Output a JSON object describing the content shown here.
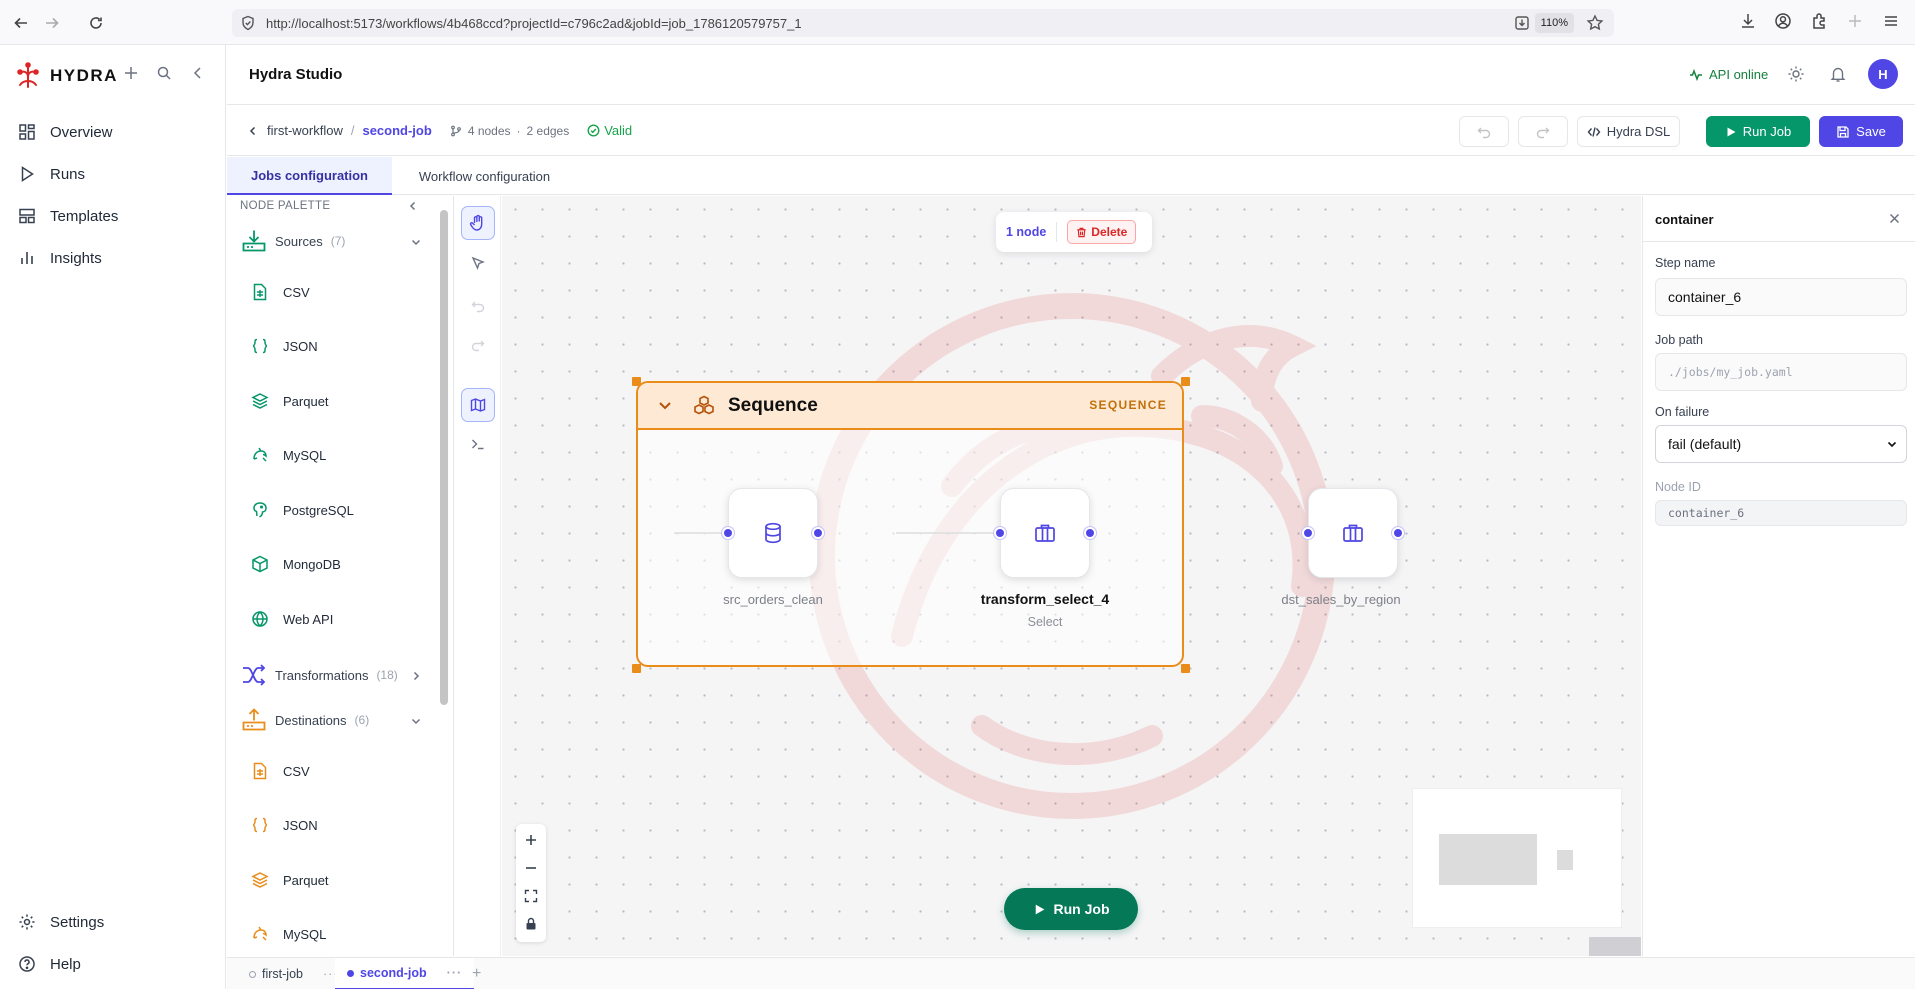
{
  "browser": {
    "url": "http://localhost:5173/workflows/4b468ccd?projectId=c796c2ad&jobId=job_1786120579757_1",
    "zoom": "110%"
  },
  "app": {
    "brand": "HYDRA",
    "title": "Hydra Studio",
    "api_status": "API online",
    "avatar_initial": "H"
  },
  "sidebar": {
    "nav": [
      {
        "label": "Overview",
        "icon": "grid-icon"
      },
      {
        "label": "Runs",
        "icon": "play-icon"
      },
      {
        "label": "Templates",
        "icon": "layout-icon"
      },
      {
        "label": "Insights",
        "icon": "bar-chart-icon"
      }
    ],
    "bottom": [
      {
        "label": "Settings",
        "icon": "gear-icon"
      },
      {
        "label": "Help",
        "icon": "help-icon"
      }
    ]
  },
  "breadcrumb": {
    "workflow": "first-workflow",
    "separator": "/",
    "job": "second-job",
    "nodes": "4 nodes",
    "dot": "·",
    "edges": "2 edges",
    "status": "Valid"
  },
  "actions": {
    "dsl": "Hydra DSL",
    "run": "Run Job",
    "save": "Save"
  },
  "tabs": [
    {
      "label": "Jobs configuration",
      "active": true
    },
    {
      "label": "Workflow configuration",
      "active": false
    }
  ],
  "palette": {
    "header": "NODE PALETTE",
    "groups": [
      {
        "label": "Sources",
        "count": "(7)"
      },
      {
        "label": "Transformations",
        "count": "(18)"
      },
      {
        "label": "Destinations",
        "count": "(6)"
      }
    ],
    "sources": [
      "CSV",
      "JSON",
      "Parquet",
      "MySQL",
      "PostgreSQL",
      "MongoDB",
      "Web API"
    ],
    "destinations": [
      "CSV",
      "JSON",
      "Parquet",
      "MySQL"
    ]
  },
  "canvas": {
    "selection_count": "1 node",
    "delete_label": "Delete",
    "sequence_title": "Sequence",
    "sequence_badge": "SEQUENCE",
    "nodes": [
      {
        "label": "src_orders_clean",
        "icon": "database-icon"
      },
      {
        "label": "transform_select_4",
        "sub": "Select",
        "icon": "briefcase-icon"
      },
      {
        "label": "dst_sales_by_region",
        "icon": "briefcase-icon"
      }
    ],
    "run_label": "Run Job"
  },
  "properties": {
    "title": "container",
    "step_name_label": "Step name",
    "step_name_value": "container_6",
    "job_path_label": "Job path",
    "job_path_placeholder": "./jobs/my_job.yaml",
    "on_failure_label": "On failure",
    "on_failure_value": "fail (default)",
    "node_id_label": "Node ID",
    "node_id_value": "container_6"
  },
  "bottom_tabs": [
    {
      "label": "first-job",
      "active": false
    },
    {
      "label": "second-job",
      "active": true
    }
  ],
  "colors": {
    "accent": "#4f46e5",
    "success": "#059669",
    "sequence": "#ea8c1a",
    "danger": "#dc2626"
  }
}
